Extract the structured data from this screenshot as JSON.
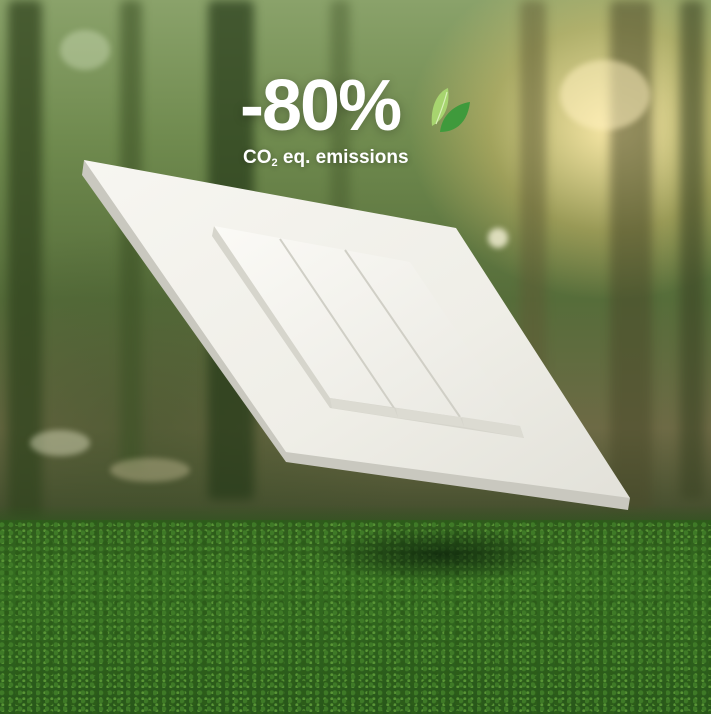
{
  "headline": {
    "value": "-80%"
  },
  "subline": {
    "prefix": "CO",
    "subscript": "2",
    "suffix": " eq. emissions"
  },
  "icons": {
    "leaf": "leaf-icon"
  },
  "colors": {
    "text": "#ffffff",
    "leaf_light": "#9ccf6a",
    "leaf_dark": "#3c9a3a",
    "moss": "#336b1f",
    "switch": "#f3f2ec"
  }
}
